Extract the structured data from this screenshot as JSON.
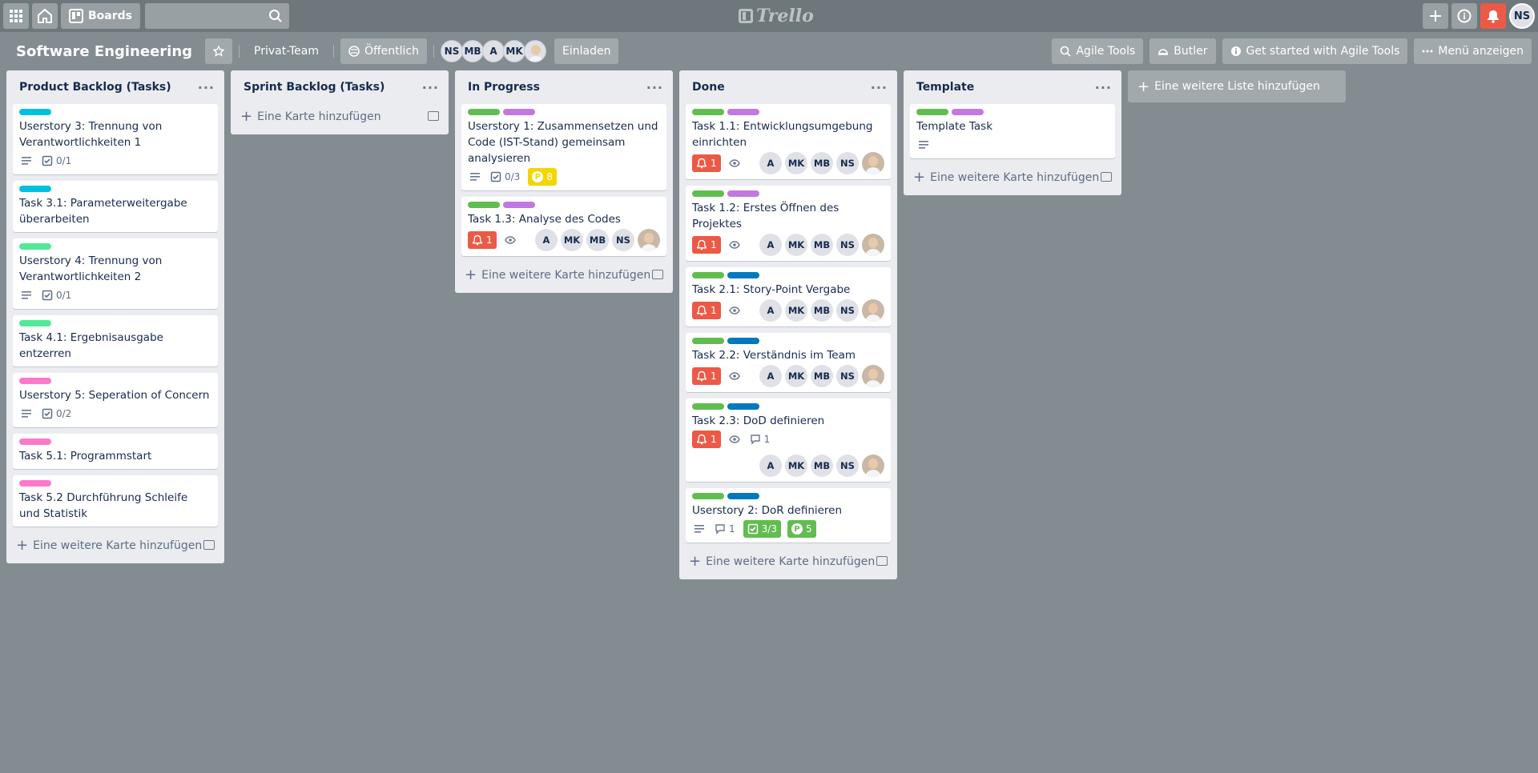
{
  "topbar": {
    "boards_label": "Boards",
    "logo_text": "Trello",
    "user_initials": "NS"
  },
  "board": {
    "title": "Software Engineering",
    "team": "Privat-Team",
    "visibility": "Öffentlich",
    "members": [
      "NS",
      "MB",
      "A",
      "MK"
    ],
    "invite": "Einladen",
    "agile_tools": "Agile Tools",
    "butler": "Butler",
    "get_started": "Get started with Agile Tools",
    "menu": "Menü anzeigen"
  },
  "colors": {
    "green": "#61bd4f",
    "purple": "#c377e0",
    "sky": "#00c2e0",
    "lime": "#51e898",
    "pink": "#ff78cb",
    "blue": "#0079bf",
    "red": "#eb5a46",
    "yellow": "#f2d600"
  },
  "lists": [
    {
      "title": "Product Backlog (Tasks)",
      "add_label": "Eine weitere Karte hinzufügen",
      "cards": [
        {
          "labels": [
            "sky"
          ],
          "title": "Userstory 3: Trennung von Verantwortlichkeiten 1",
          "desc": true,
          "checklist": "0/1"
        },
        {
          "labels": [
            "sky"
          ],
          "title": "Task 3.1: Parameterweitergabe überarbeiten"
        },
        {
          "labels": [
            "lime"
          ],
          "title": "Userstory 4: Trennung von Verantwortlichkeiten 2",
          "desc": true,
          "checklist": "0/1"
        },
        {
          "labels": [
            "lime"
          ],
          "title": "Task 4.1: Ergebnisausgabe entzerren"
        },
        {
          "labels": [
            "pink"
          ],
          "title": "Userstory 5: Seperation of Concern",
          "desc": true,
          "checklist": "0/2"
        },
        {
          "labels": [
            "pink"
          ],
          "title": "Task 5.1: Programmstart"
        },
        {
          "labels": [
            "pink"
          ],
          "title": "Task 5.2 Durchführung Schleife und Statistik"
        }
      ]
    },
    {
      "title": "Sprint Backlog (Tasks)",
      "add_label": "Eine Karte hinzufügen",
      "cards": []
    },
    {
      "title": "In Progress",
      "add_label": "Eine weitere Karte hinzufügen",
      "cards": [
        {
          "labels": [
            "green",
            "purple"
          ],
          "title": "Userstory 1: Zusammensetzen und Code (IST-Stand) gemeinsam analysieren",
          "desc": true,
          "checklist": "0/3",
          "points": "8"
        },
        {
          "labels": [
            "green",
            "purple"
          ],
          "title": "Task 1.3: Analyse des Codes",
          "alert": "1",
          "watch": true,
          "members": [
            "A",
            "MK",
            "MB",
            "NS",
            "photo"
          ]
        }
      ]
    },
    {
      "title": "Done",
      "add_label": "Eine weitere Karte hinzufügen",
      "cards": [
        {
          "labels": [
            "green",
            "purple"
          ],
          "title": "Task 1.1: Entwicklungsumgebung einrichten",
          "alert": "1",
          "watch": true,
          "members": [
            "A",
            "MK",
            "MB",
            "NS",
            "photo"
          ]
        },
        {
          "labels": [
            "green",
            "purple"
          ],
          "title": "Task 1.2: Erstes Öffnen des Projektes",
          "alert": "1",
          "watch": true,
          "members": [
            "A",
            "MK",
            "MB",
            "NS",
            "photo"
          ]
        },
        {
          "labels": [
            "green",
            "blue"
          ],
          "title": "Task 2.1: Story-Point Vergabe",
          "alert": "1",
          "watch": true,
          "members": [
            "A",
            "MK",
            "MB",
            "NS",
            "photo"
          ]
        },
        {
          "labels": [
            "green",
            "blue"
          ],
          "title": "Task 2.2: Verständnis im Team",
          "alert": "1",
          "watch": true,
          "members": [
            "A",
            "MK",
            "MB",
            "NS",
            "photo"
          ]
        },
        {
          "labels": [
            "green",
            "blue"
          ],
          "title": "Task 2.3: DoD definieren",
          "alert": "1",
          "watch": true,
          "comments": "1",
          "members": [
            "A",
            "MK",
            "MB",
            "NS",
            "photo"
          ],
          "members_wrap": true
        },
        {
          "labels": [
            "green",
            "blue"
          ],
          "title": "Userstory 2: DoR definieren",
          "desc": true,
          "comments": "1",
          "checklist_done": "3/3",
          "points_green": "5"
        }
      ]
    },
    {
      "title": "Template",
      "add_label": "Eine weitere Karte hinzufügen",
      "cards": [
        {
          "labels": [
            "green",
            "purple"
          ],
          "title": "Template Task",
          "desc": true
        }
      ]
    }
  ],
  "add_list_label": "Eine weitere Liste hinzufügen"
}
